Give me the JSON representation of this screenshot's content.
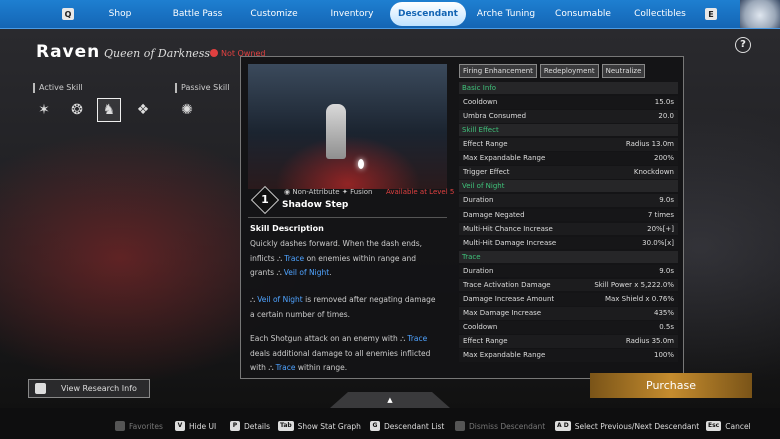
{
  "nav": {
    "key_left": "Q",
    "key_right": "E",
    "tabs": [
      {
        "label": "Shop"
      },
      {
        "label": "Battle Pass"
      },
      {
        "label": "Customize"
      },
      {
        "label": "Inventory"
      },
      {
        "label": "Descendant"
      },
      {
        "label": "Arche Tuning"
      },
      {
        "label": "Consumable"
      },
      {
        "label": "Collectibles"
      }
    ],
    "active_tab": "Descendant"
  },
  "header": {
    "name": "Raven",
    "title": "Queen of Darkness",
    "status": "Not Owned",
    "help": "?"
  },
  "skills": {
    "active_label": "Active Skill",
    "passive_label": "Passive Skill"
  },
  "panel": {
    "level": "1",
    "attribute": "Non-Attribute",
    "type": "Fusion",
    "available": "Available at Level 5",
    "skill_name": "Shadow Step",
    "desc_title": "Skill Description",
    "desc": {
      "p1_l1": "Quickly dashes forward. When the dash ends,",
      "p1_l2_a": "inflicts",
      "kw_trace": "Trace",
      "p1_l2_b": "on enemies within range and",
      "p1_l3_a": "grants",
      "kw_veil": "Veil of Night",
      "p1_l3_b": ".",
      "p2_l1_b": "is removed after negating damage",
      "p2_l2": "a certain number of times.",
      "p3_l1": "Each Shotgun attack on an enemy with",
      "p3_l2": "deals additional damage to all enemies inflicted",
      "p3_l3_a": "with",
      "p3_l3_b": "within range."
    },
    "tags": [
      "Firing Enhancement",
      "Redeployment",
      "Neutralize"
    ],
    "sections": [
      {
        "title": "Basic Info",
        "rows": [
          {
            "k": "Cooldown",
            "v": "15.0s"
          },
          {
            "k": "Umbra Consumed",
            "v": "20.0"
          }
        ]
      },
      {
        "title": "Skill Effect",
        "rows": [
          {
            "k": "Effect Range",
            "v": "Radius 13.0m"
          },
          {
            "k": "Max Expandable Range",
            "v": "200%"
          },
          {
            "k": "Trigger Effect",
            "v": "Knockdown"
          }
        ]
      },
      {
        "title": "Veil of Night",
        "rows": [
          {
            "k": "Duration",
            "v": "9.0s"
          },
          {
            "k": "Damage Negated",
            "v": "7 times"
          },
          {
            "k": "Multi-Hit Chance Increase",
            "v": "20%[+]"
          },
          {
            "k": "Multi-Hit Damage Increase",
            "v": "30.0%[x]"
          }
        ]
      },
      {
        "title": "Trace",
        "rows": [
          {
            "k": "Duration",
            "v": "9.0s"
          },
          {
            "k": "Trace Activation Damage",
            "v": "Skill Power x 5,222.0%"
          },
          {
            "k": "Damage Increase Amount",
            "v": "Max Shield x 0.76%"
          },
          {
            "k": "Max Damage Increase",
            "v": "435%"
          },
          {
            "k": "Cooldown",
            "v": "0.5s"
          },
          {
            "k": "Effect Range",
            "v": "Radius 35.0m"
          },
          {
            "k": "Max Expandable Range",
            "v": "100%"
          }
        ]
      }
    ]
  },
  "research_button": "View Research Info",
  "purchase_button": "Purchase",
  "hints": [
    {
      "key": "",
      "label": "Favorites",
      "dim": true
    },
    {
      "key": "V",
      "label": "Hide UI",
      "dim": false
    },
    {
      "key": "P",
      "label": "Details",
      "dim": false
    },
    {
      "key": "Tab",
      "label": "Show Stat Graph",
      "dim": false
    },
    {
      "key": "G",
      "label": "Descendant List",
      "dim": false
    },
    {
      "key": "",
      "label": "Dismiss Descendant",
      "dim": true
    },
    {
      "key": "A D",
      "label": "Select Previous/Next Descendant",
      "dim": false
    },
    {
      "key": "Esc",
      "label": "Cancel",
      "dim": false
    }
  ]
}
